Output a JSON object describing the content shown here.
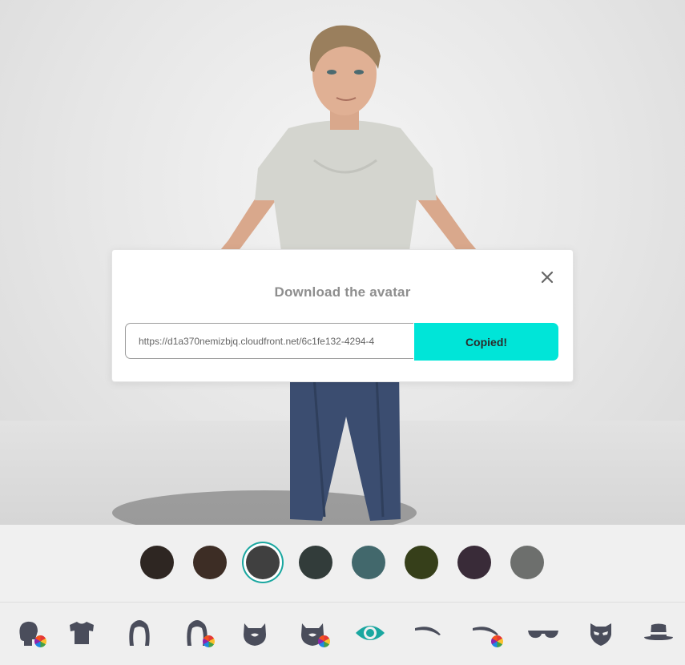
{
  "modal": {
    "title": "Download the avatar",
    "url_value": "https://d1a370nemizbjq.cloudfront.net/6c1fe132-4294-4",
    "copy_label": "Copied!",
    "close_icon": "close-icon"
  },
  "colors": {
    "accent": "#00e5d8",
    "selection_ring": "#1aa7a0",
    "icon": "#4a4d5b",
    "icon_active": "#1aa7a0"
  },
  "swatches": [
    {
      "color": "#2e2622",
      "selected": false
    },
    {
      "color": "#3d2d25",
      "selected": false
    },
    {
      "color": "#404040",
      "selected": true
    },
    {
      "color": "#323c3a",
      "selected": false
    },
    {
      "color": "#42686c",
      "selected": false
    },
    {
      "color": "#363f1a",
      "selected": false
    },
    {
      "color": "#392b38",
      "selected": false
    },
    {
      "color": "#6d6f6d",
      "selected": false
    }
  ],
  "categories": [
    {
      "icon": "head-skin-icon",
      "color_wheel": true,
      "active": false
    },
    {
      "icon": "shirt-icon",
      "color_wheel": false,
      "active": false
    },
    {
      "icon": "hair-icon",
      "color_wheel": false,
      "active": false
    },
    {
      "icon": "hair-color-icon",
      "color_wheel": true,
      "active": false
    },
    {
      "icon": "beard-icon",
      "color_wheel": false,
      "active": false
    },
    {
      "icon": "beard-color-icon",
      "color_wheel": true,
      "active": false
    },
    {
      "icon": "eye-icon",
      "color_wheel": false,
      "active": true
    },
    {
      "icon": "eyebrow-icon",
      "color_wheel": false,
      "active": false
    },
    {
      "icon": "eyebrow-color-icon",
      "color_wheel": true,
      "active": false
    },
    {
      "icon": "glasses-icon",
      "color_wheel": false,
      "active": false
    },
    {
      "icon": "face-mask-icon",
      "color_wheel": false,
      "active": false
    },
    {
      "icon": "hat-icon",
      "color_wheel": false,
      "active": false
    }
  ]
}
